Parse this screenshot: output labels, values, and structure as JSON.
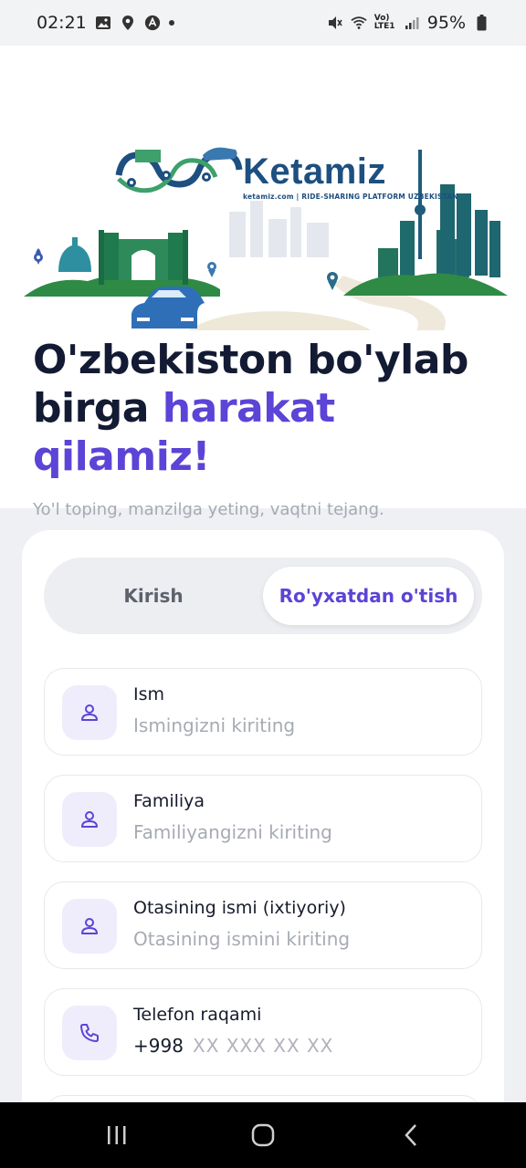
{
  "status_bar": {
    "time": "02:21",
    "battery": "95%",
    "network": "Vo) LTE1",
    "icons": [
      "gallery-icon",
      "location-icon",
      "app-icon",
      "dot-icon",
      "mute-icon",
      "wifi-icon",
      "signal-icon",
      "battery-icon"
    ]
  },
  "brand": {
    "name": "Ketamiz",
    "tagline": "ketamiz.com | RIDE-SHARING PLATFORM UZBEKISTAN"
  },
  "hero": {
    "title_part1": "O'zbekiston bo'ylab",
    "title_part2": "birga ",
    "title_accent1": "harakat",
    "title_accent2": "qilamiz!",
    "subtitle": "Yo'l toping, manzilga yeting, vaqtni tejang."
  },
  "tabs": {
    "login": "Kirish",
    "register": "Ro'yxatdan o'tish",
    "active": "register"
  },
  "form": {
    "fields": [
      {
        "label": "Ism",
        "placeholder": "Ismingizni kiriting",
        "icon": "user-icon"
      },
      {
        "label": "Familiya",
        "placeholder": "Familiyangizni kiriting",
        "icon": "user-icon"
      },
      {
        "label": "Otasining ismi (ixtiyoriy)",
        "placeholder": "Otasining ismini kiriting",
        "icon": "user-icon"
      },
      {
        "label": "Telefon raqami",
        "prefix": "+998",
        "placeholder": "XX XXX XX XX",
        "icon": "phone-icon"
      }
    ]
  },
  "colors": {
    "accent": "#5b44d6",
    "brand_blue": "#1d4f80",
    "green": "#2f8a43",
    "icon_bg": "#efedfb"
  },
  "nav": {
    "icons": [
      "recent-apps-icon",
      "home-icon",
      "back-icon"
    ]
  }
}
